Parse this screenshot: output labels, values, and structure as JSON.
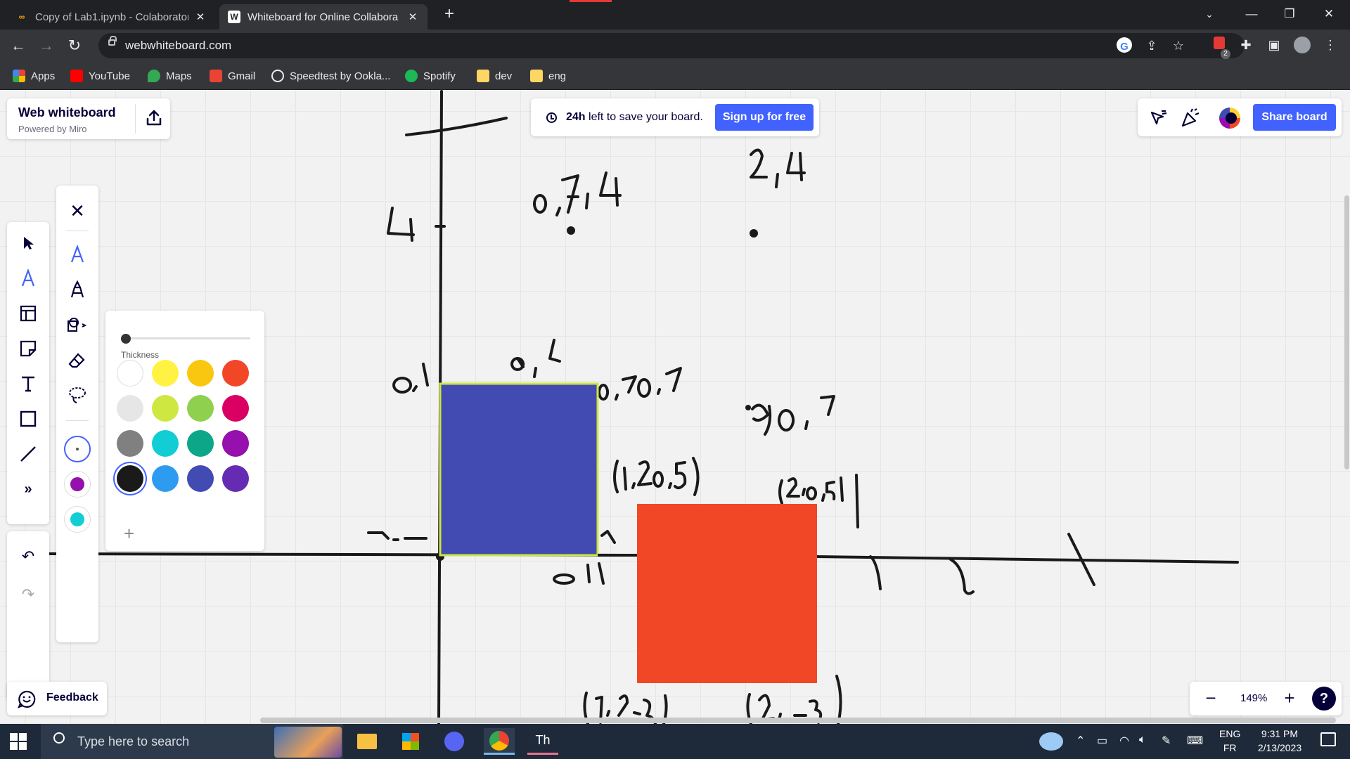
{
  "browser": {
    "tabs": [
      {
        "title": "Copy of Lab1.ipynb - Colaborator",
        "favicon": "colab-icon",
        "active": false
      },
      {
        "title": "Whiteboard for Online Collabora",
        "favicon": "W",
        "active": true
      }
    ],
    "url": "webwhiteboard.com",
    "extension_badge": "2",
    "bookmarks": [
      "Apps",
      "YouTube",
      "Maps",
      "Gmail",
      "Speedtest by Ookla...",
      "Spotify",
      "dev",
      "eng"
    ]
  },
  "board": {
    "brand": {
      "name": "Web whiteboard",
      "powered_by": "Powered by Miro"
    },
    "notice": {
      "bold": "24h",
      "text": " left to save your board.",
      "signup": "Sign up for free"
    },
    "share_label": "Share board",
    "thickness_label": "Thickness",
    "feedback_label": "Feedback",
    "zoom_level": "149%",
    "help": "?",
    "swatches": [
      "#ffffff",
      "#fff242",
      "#fac710",
      "#f24726",
      "#e6e6e6",
      "#cee741",
      "#8fd14f",
      "#da0063",
      "#808080",
      "#12cdd4",
      "#0ca789",
      "#9510ac",
      "#1a1a1a",
      "#2d9bf0",
      "#414bb2",
      "#652cb3"
    ],
    "selected_swatch": "#1a1a1a",
    "recent_colors": [
      "#ffffff",
      "#9510ac",
      "#12cdd4"
    ],
    "shapes": {
      "blue_rect_color": "#414bb2",
      "blue_rect_border": "#cee741",
      "red_rect_color": "#f24726"
    }
  },
  "taskbar": {
    "search_placeholder": "Type here to search",
    "lang": "ENG",
    "lang2": "FR",
    "time": "9:31 PM",
    "date": "2/13/2023"
  }
}
